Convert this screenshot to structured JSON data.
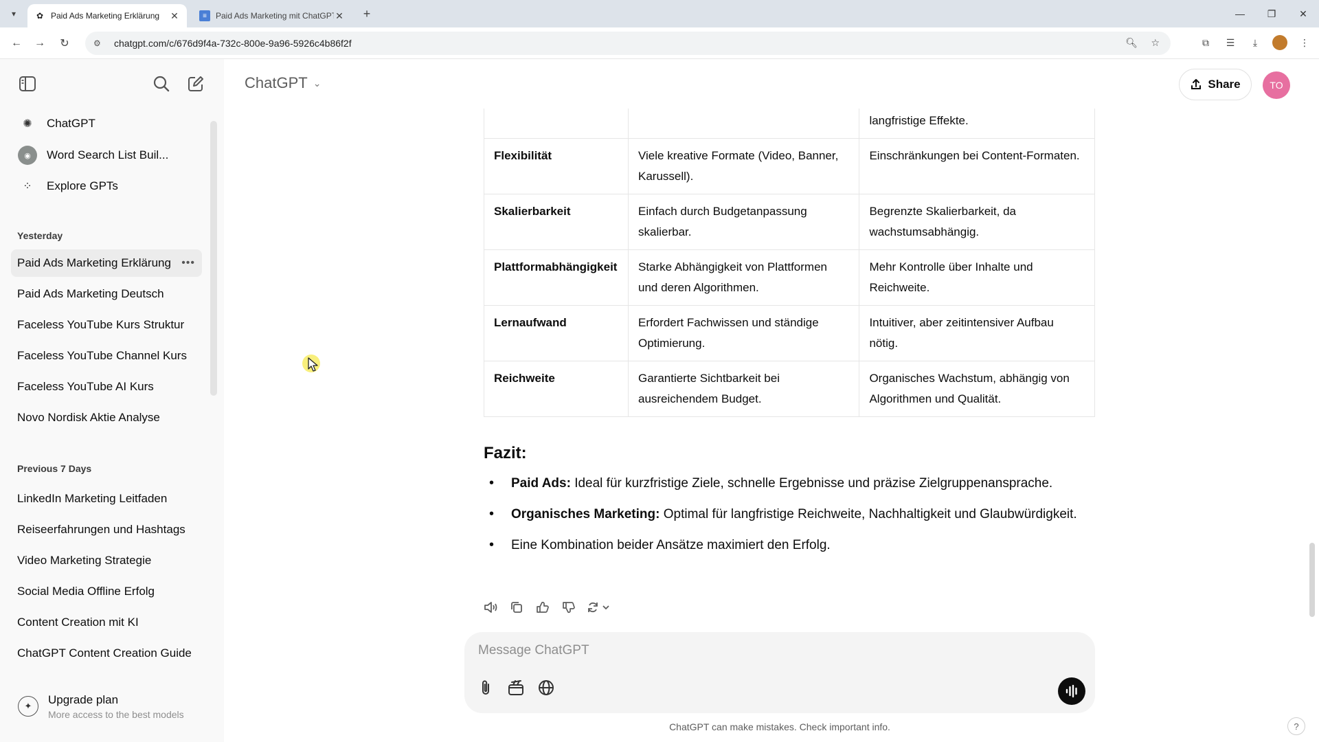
{
  "browser": {
    "tabs": [
      {
        "title": "Paid Ads Marketing Erklärung",
        "active": true
      },
      {
        "title": "Paid Ads Marketing mit ChatGPT",
        "active": false
      }
    ],
    "url": "chatgpt.com/c/676d9f4a-732c-800e-9a96-5926c4b86f2f"
  },
  "sidebar": {
    "top_items": [
      {
        "label": "ChatGPT",
        "icon": "openai-logo-icon"
      },
      {
        "label": "Word Search List Buil...",
        "icon": "gpt-avatar"
      },
      {
        "label": "Explore GPTs",
        "icon": "grid-icon"
      }
    ],
    "sections": [
      {
        "title": "Yesterday",
        "items": [
          "Paid Ads Marketing Erklärung",
          "Paid Ads Marketing Deutsch",
          "Faceless YouTube Kurs Struktur",
          "Faceless YouTube Channel Kurs",
          "Faceless YouTube AI Kurs",
          "Novo Nordisk Aktie Analyse"
        ]
      },
      {
        "title": "Previous 7 Days",
        "items": [
          "LinkedIn Marketing Leitfaden",
          "Reiseerfahrungen und Hashtags",
          "Video Marketing Strategie",
          "Social Media Offline Erfolg",
          "Content Creation mit KI",
          "ChatGPT Content Creation Guide"
        ]
      }
    ],
    "upgrade": {
      "title": "Upgrade plan",
      "subtitle": "More access to the best models"
    }
  },
  "header": {
    "model": "ChatGPT",
    "share_label": "Share",
    "avatar_initials": "TO"
  },
  "table": {
    "rows": [
      {
        "aspect": "",
        "paid": "",
        "organic": "langfristige Effekte."
      },
      {
        "aspect": "Flexibilität",
        "paid": "Viele kreative Formate (Video, Banner, Karussell).",
        "organic": "Einschränkungen bei Content-Formaten."
      },
      {
        "aspect": "Skalierbarkeit",
        "paid": "Einfach durch Budgetanpassung skalierbar.",
        "organic": "Begrenzte Skalierbarkeit, da wachstumsabhängig."
      },
      {
        "aspect": "Plattformabhängigkeit",
        "paid": "Starke Abhängigkeit von Plattformen und deren Algorithmen.",
        "organic": "Mehr Kontrolle über Inhalte und Reichweite."
      },
      {
        "aspect": "Lernaufwand",
        "paid": "Erfordert Fachwissen und ständige Optimierung.",
        "organic": "Intuitiver, aber zeitintensiver Aufbau nötig."
      },
      {
        "aspect": "Reichweite",
        "paid": "Garantierte Sichtbarkeit bei ausreichendem Budget.",
        "organic": "Organisches Wachstum, abhängig von Algorithmen und Qualität."
      }
    ]
  },
  "summary": {
    "heading": "Fazit:",
    "points": [
      {
        "bold": "Paid Ads:",
        "text": " Ideal für kurzfristige Ziele, schnelle Ergebnisse und präzise Zielgruppenansprache."
      },
      {
        "bold": "Organisches Marketing:",
        "text": " Optimal für langfristige Reichweite, Nachhaltigkeit und Glaubwürdigkeit."
      },
      {
        "bold": "",
        "text": "Eine Kombination beider Ansätze maximiert den Erfolg."
      }
    ]
  },
  "composer": {
    "placeholder": "Message ChatGPT",
    "disclaimer": "ChatGPT can make mistakes. Check important info."
  },
  "help_label": "?"
}
